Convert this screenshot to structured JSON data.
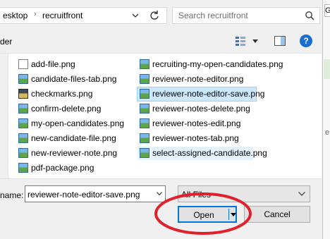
{
  "address_bar": {
    "crumbs": [
      "esktop",
      "recruitfront"
    ],
    "separator": "›"
  },
  "search": {
    "placeholder": "Search recruitfront"
  },
  "toolbar": {
    "left_label": "der"
  },
  "help_label": "?",
  "files": {
    "left": [
      {
        "name": "add-file.png",
        "icon": "file-icon"
      },
      {
        "name": "candidate-files-tab.png",
        "icon": "image-icon"
      },
      {
        "name": "checkmarks.png",
        "icon": "image-icon"
      },
      {
        "name": "confirm-delete.png",
        "icon": "image-icon"
      },
      {
        "name": "my-open-candidates.png",
        "icon": "image-icon"
      },
      {
        "name": "new-candidate-file.png",
        "icon": "image-icon"
      },
      {
        "name": "new-reviewer-note.png",
        "icon": "image-icon"
      },
      {
        "name": "pdf-package.png",
        "icon": "image-icon"
      }
    ],
    "right": [
      {
        "name": "recruiting-my-open-candidates.png",
        "icon": "image-icon"
      },
      {
        "name": "reviewer-note-editor.png",
        "icon": "image-icon"
      },
      {
        "name": "reviewer-note-editor-save.png",
        "icon": "image-icon",
        "state": "selected"
      },
      {
        "name": "reviewer-notes-delete.png",
        "icon": "image-icon"
      },
      {
        "name": "reviewer-notes-edit.png",
        "icon": "image-icon"
      },
      {
        "name": "reviewer-notes-tab.png",
        "icon": "image-icon"
      },
      {
        "name": "select-assigned-candidate.png",
        "icon": "image-icon",
        "state": "hover"
      }
    ]
  },
  "filename": {
    "label": "name:",
    "value": "reviewer-note-editor-save.png"
  },
  "file_type": {
    "value": "All Files"
  },
  "buttons": {
    "open": "Open",
    "cancel": "Cancel"
  },
  "right_strip": {
    "g": "G",
    "e": "e"
  },
  "colors": {
    "accent": "#0078d7",
    "selected_bg": "#cce8ff",
    "hover_bg": "#e5f3ff",
    "annotation": "#e0202a"
  }
}
